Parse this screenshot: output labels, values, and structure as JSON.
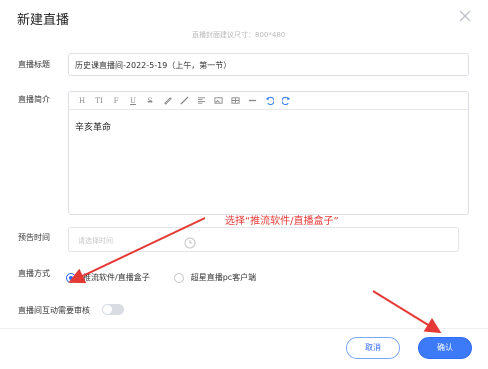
{
  "dialog": {
    "title": "新建直播",
    "cover_hint": "直播封面建议尺寸：800*480"
  },
  "form": {
    "title_label": "直播标题",
    "title_value": "历史课直播间-2022-5-19（上午，第一节）",
    "intro_label": "直播简介",
    "intro_content": "辛亥革命",
    "toolbar": [
      "H",
      "TI",
      "F",
      "U",
      "S",
      "paint-icon",
      "brush-icon",
      "align-icon",
      "image-icon",
      "table-icon",
      "hr-icon",
      "undo-icon",
      "redo-icon"
    ],
    "preview_label": "预告时间",
    "preview_placeholder": "请选择时间",
    "mode_label": "直播方式",
    "mode_options": [
      "推流软件/直播盒子",
      "超星直播pc客户端"
    ],
    "mode_selected": "推流软件/直播盒子",
    "review_label": "直播间互动需要审核",
    "review_enabled": false
  },
  "annotation": {
    "text": "选择“推流软件/直播盒子”",
    "color": "#e53935"
  },
  "buttons": {
    "cancel": "取消",
    "confirm": "确认"
  },
  "colors": {
    "accent": "#2f6bff"
  }
}
